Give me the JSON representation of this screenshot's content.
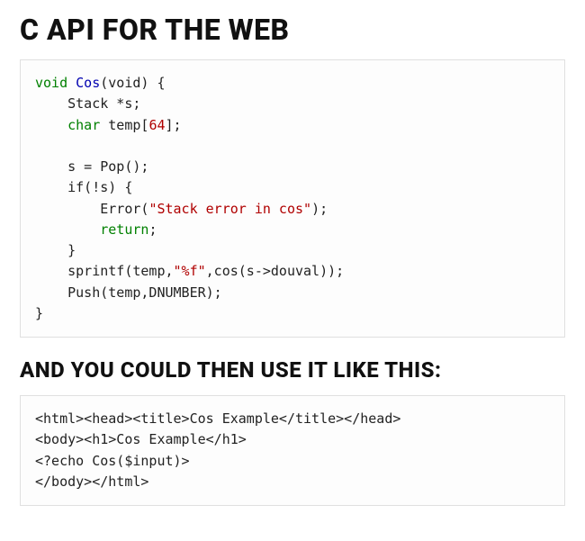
{
  "heading1": "C API FOR THE WEB",
  "heading2": "AND YOU COULD THEN USE IT LIKE THIS:",
  "code1": {
    "line1_void": "void",
    "line1_fn": "Cos",
    "line1_rest": "(void) {",
    "line2": "    Stack *s;",
    "line3_kw": "    char",
    "line3_rest": " temp[",
    "line3_num": "64",
    "line3_end": "];",
    "line4": "",
    "line5": "    s = Pop();",
    "line6": "    if(!s) {",
    "line7_pre": "        Error(",
    "line7_str": "\"Stack error in cos\"",
    "line7_post": ");",
    "line8_kw": "        return",
    "line8_post": ";",
    "line9": "    }",
    "line10_pre": "    sprintf(temp,",
    "line10_str": "\"%f\"",
    "line10_post": ",cos(s->douval));",
    "line11": "    Push(temp,DNUMBER);",
    "line12": "}"
  },
  "code2": {
    "line1": "<html><head><title>Cos Example</title></head>",
    "line2": "<body><h1>Cos Example</h1>",
    "line3": "<?echo Cos($input)>",
    "line4": "</body></html>"
  }
}
